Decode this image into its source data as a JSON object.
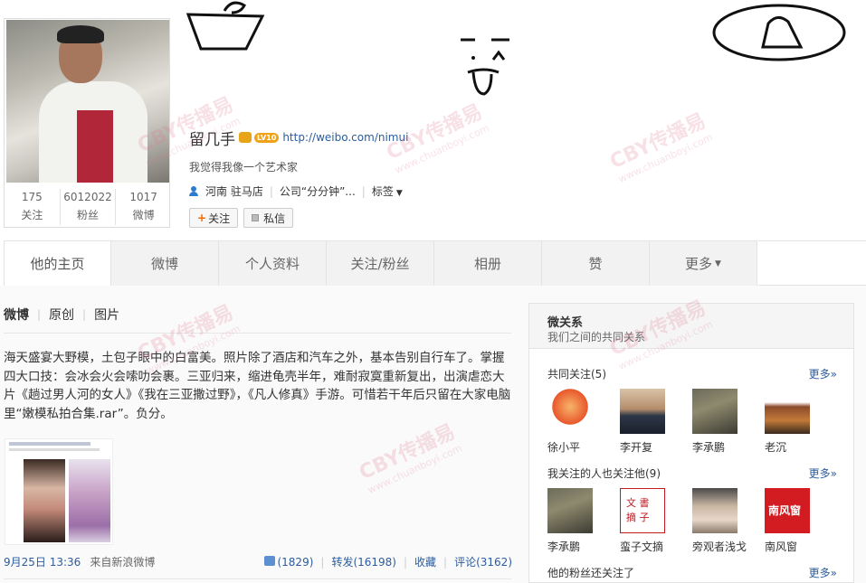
{
  "profile": {
    "name": "留几手",
    "level_badge": "LV10",
    "url": "http://weibo.com/nimui",
    "bio": "我觉得我像一个艺术家",
    "location": "河南 驻马店",
    "company": "公司“分分钟”...",
    "tags_label": "标签",
    "follow_button": "关注",
    "message_button": "私信",
    "stats": [
      {
        "num": "175",
        "label": "关注"
      },
      {
        "num": "6012022",
        "label": "粉丝"
      },
      {
        "num": "1017",
        "label": "微博"
      }
    ]
  },
  "tabs": [
    {
      "label": "他的主页"
    },
    {
      "label": "微博"
    },
    {
      "label": "个人资料"
    },
    {
      "label": "关注/粉丝"
    },
    {
      "label": "相册"
    },
    {
      "label": "赞"
    },
    {
      "label": "更多"
    }
  ],
  "feed": {
    "filters": [
      "微博",
      "原创",
      "图片"
    ],
    "post_text": "海天盛宴大野模，土包子眼中的白富美。照片除了酒店和汽车之外，基本告别自行车了。掌握四大口技：会冰会火会嗦叻会裹。三亚归来，缩进龟壳半年，难耐寂寞重新复出，出演虐恋大片《趟过男人河的女人》《我在三亚撒过野》，《凡人修真》手游。可惜若干年后只留在大家电脑里“嫩模私拍合集.rar”。负分。",
    "time": "9月25日 13:36",
    "source_prefix": "来自",
    "source": "新浪微博",
    "likes": "(1829)",
    "repost": "转发(16198)",
    "favorite": "收藏",
    "comment": "评论(3162)"
  },
  "sidebar": {
    "title": "微关系",
    "subtitle": "我们之间的共同关系",
    "more_label": "更多»",
    "sections": [
      {
        "heading": "共同关注(5)",
        "people": [
          "徐小平",
          "李开复",
          "李承鹏",
          "老沉"
        ]
      },
      {
        "heading": "我关注的人也关注他(9)",
        "people": [
          "李承鹏",
          "蛮子文摘",
          "旁观者浅戈",
          "南风窗"
        ]
      },
      {
        "heading": "他的粉丝还关注了",
        "people": []
      }
    ]
  },
  "watermark": {
    "brand": "CBY传播易",
    "site": "www.chuanboyi.com"
  }
}
